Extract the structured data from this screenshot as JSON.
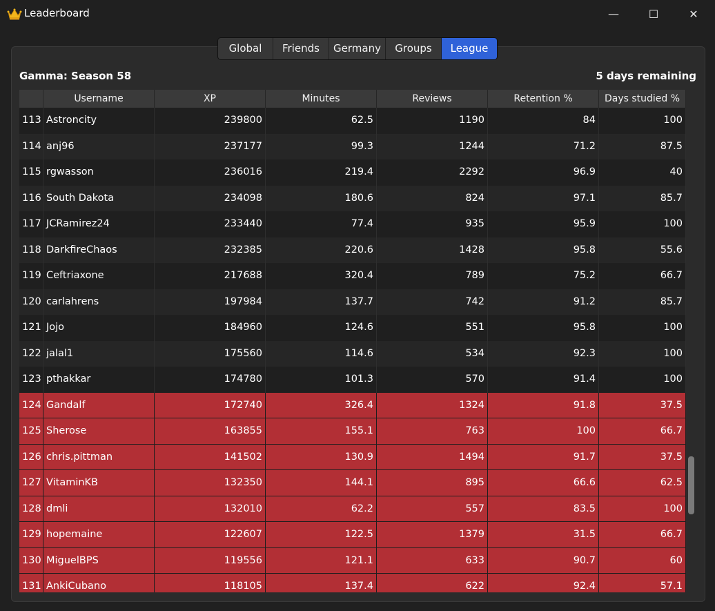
{
  "window": {
    "title": "Leaderboard",
    "minimize": "—",
    "maximize": "☐",
    "close": "✕"
  },
  "tabs": [
    "Global",
    "Friends",
    "Germany",
    "Groups",
    "League"
  ],
  "active_tab": "League",
  "league": {
    "title": "Gamma: Season 58",
    "remaining": "5 days remaining"
  },
  "columns": [
    "",
    "Username",
    "XP",
    "Minutes",
    "Reviews",
    "Retention %",
    "Days studied %"
  ],
  "rows": [
    {
      "rank": "113",
      "user": "Astroncity",
      "xp": "239800",
      "minutes": "62.5",
      "reviews": "1190",
      "retention": "84",
      "days": "100",
      "relegated": false
    },
    {
      "rank": "114",
      "user": "anj96",
      "xp": "237177",
      "minutes": "99.3",
      "reviews": "1244",
      "retention": "71.2",
      "days": "87.5",
      "relegated": false
    },
    {
      "rank": "115",
      "user": "rgwasson",
      "xp": "236016",
      "minutes": "219.4",
      "reviews": "2292",
      "retention": "96.9",
      "days": "40",
      "relegated": false
    },
    {
      "rank": "116",
      "user": "South Dakota",
      "xp": "234098",
      "minutes": "180.6",
      "reviews": "824",
      "retention": "97.1",
      "days": "85.7",
      "relegated": false
    },
    {
      "rank": "117",
      "user": "JCRamirez24",
      "xp": "233440",
      "minutes": "77.4",
      "reviews": "935",
      "retention": "95.9",
      "days": "100",
      "relegated": false
    },
    {
      "rank": "118",
      "user": "DarkfireChaos",
      "xp": "232385",
      "minutes": "220.6",
      "reviews": "1428",
      "retention": "95.8",
      "days": "55.6",
      "relegated": false
    },
    {
      "rank": "119",
      "user": "Ceftriaxone",
      "xp": "217688",
      "minutes": "320.4",
      "reviews": "789",
      "retention": "75.2",
      "days": "66.7",
      "relegated": false
    },
    {
      "rank": "120",
      "user": "carlahrens",
      "xp": "197984",
      "minutes": "137.7",
      "reviews": "742",
      "retention": "91.2",
      "days": "85.7",
      "relegated": false
    },
    {
      "rank": "121",
      "user": "Jojo",
      "xp": "184960",
      "minutes": "124.6",
      "reviews": "551",
      "retention": "95.8",
      "days": "100",
      "relegated": false
    },
    {
      "rank": "122",
      "user": "jalal1",
      "xp": "175560",
      "minutes": "114.6",
      "reviews": "534",
      "retention": "92.3",
      "days": "100",
      "relegated": false
    },
    {
      "rank": "123",
      "user": "pthakkar",
      "xp": "174780",
      "minutes": "101.3",
      "reviews": "570",
      "retention": "91.4",
      "days": "100",
      "relegated": false
    },
    {
      "rank": "124",
      "user": "Gandalf",
      "xp": "172740",
      "minutes": "326.4",
      "reviews": "1324",
      "retention": "91.8",
      "days": "37.5",
      "relegated": true
    },
    {
      "rank": "125",
      "user": "Sherose",
      "xp": "163855",
      "minutes": "155.1",
      "reviews": "763",
      "retention": "100",
      "days": "66.7",
      "relegated": true
    },
    {
      "rank": "126",
      "user": "chris.pittman",
      "xp": "141502",
      "minutes": "130.9",
      "reviews": "1494",
      "retention": "91.7",
      "days": "37.5",
      "relegated": true
    },
    {
      "rank": "127",
      "user": "VitaminKB",
      "xp": "132350",
      "minutes": "144.1",
      "reviews": "895",
      "retention": "66.6",
      "days": "62.5",
      "relegated": true
    },
    {
      "rank": "128",
      "user": "dmli",
      "xp": "132010",
      "minutes": "62.2",
      "reviews": "557",
      "retention": "83.5",
      "days": "100",
      "relegated": true
    },
    {
      "rank": "129",
      "user": "hopemaine",
      "xp": "122607",
      "minutes": "122.5",
      "reviews": "1379",
      "retention": "31.5",
      "days": "66.7",
      "relegated": true
    },
    {
      "rank": "130",
      "user": "MiguelBPS",
      "xp": "119556",
      "minutes": "121.1",
      "reviews": "633",
      "retention": "90.7",
      "days": "60",
      "relegated": true
    },
    {
      "rank": "131",
      "user": "AnkiCubano",
      "xp": "118105",
      "minutes": "137.4",
      "reviews": "622",
      "retention": "92.4",
      "days": "57.1",
      "relegated": true
    }
  ],
  "icons": {
    "app": "crown-icon"
  },
  "colors": {
    "accent": "#2f62d9",
    "relegation": "#b22f35",
    "crown": "#f2b51c"
  }
}
